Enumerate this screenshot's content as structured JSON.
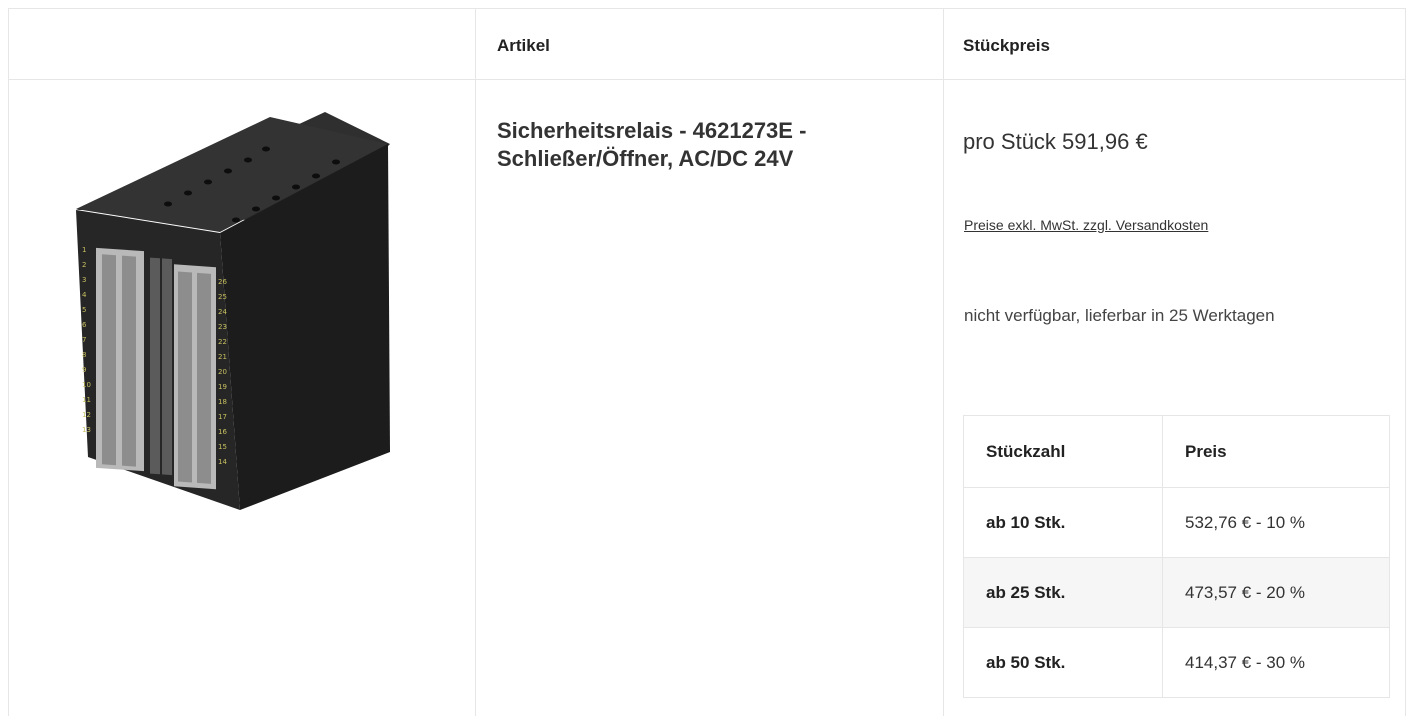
{
  "header": {
    "col_article": "Artikel",
    "col_unit_price": "Stückpreis"
  },
  "product": {
    "image_icon": "safety-relay-image",
    "title": "Sicherheitsrelais - 4621273E - Schließer/Öffner, AC/DC 24V",
    "unit_price": "pro Stück 591,96 €",
    "price_note": "Preise exkl. MwSt. zzgl. Versandkosten",
    "availability": "nicht verfügbar, lieferbar in 25 Werktagen",
    "terminal_labels_left": [
      "1",
      "2",
      "3",
      "4",
      "5",
      "6",
      "7",
      "8",
      "9",
      "10",
      "11",
      "12",
      "13"
    ],
    "terminal_labels_right": [
      "26",
      "25",
      "24",
      "23",
      "22",
      "21",
      "20",
      "19",
      "18",
      "17",
      "16",
      "15",
      "14"
    ]
  },
  "tier_table": {
    "col_quantity": "Stückzahl",
    "col_price": "Preis",
    "rows": [
      {
        "quantity": "ab 10 Stk.",
        "price": "532,76 € - 10 %"
      },
      {
        "quantity": "ab 25 Stk.",
        "price": "473,57 € - 20 %"
      },
      {
        "quantity": "ab 50 Stk.",
        "price": "414,37 € - 30 %"
      }
    ]
  }
}
